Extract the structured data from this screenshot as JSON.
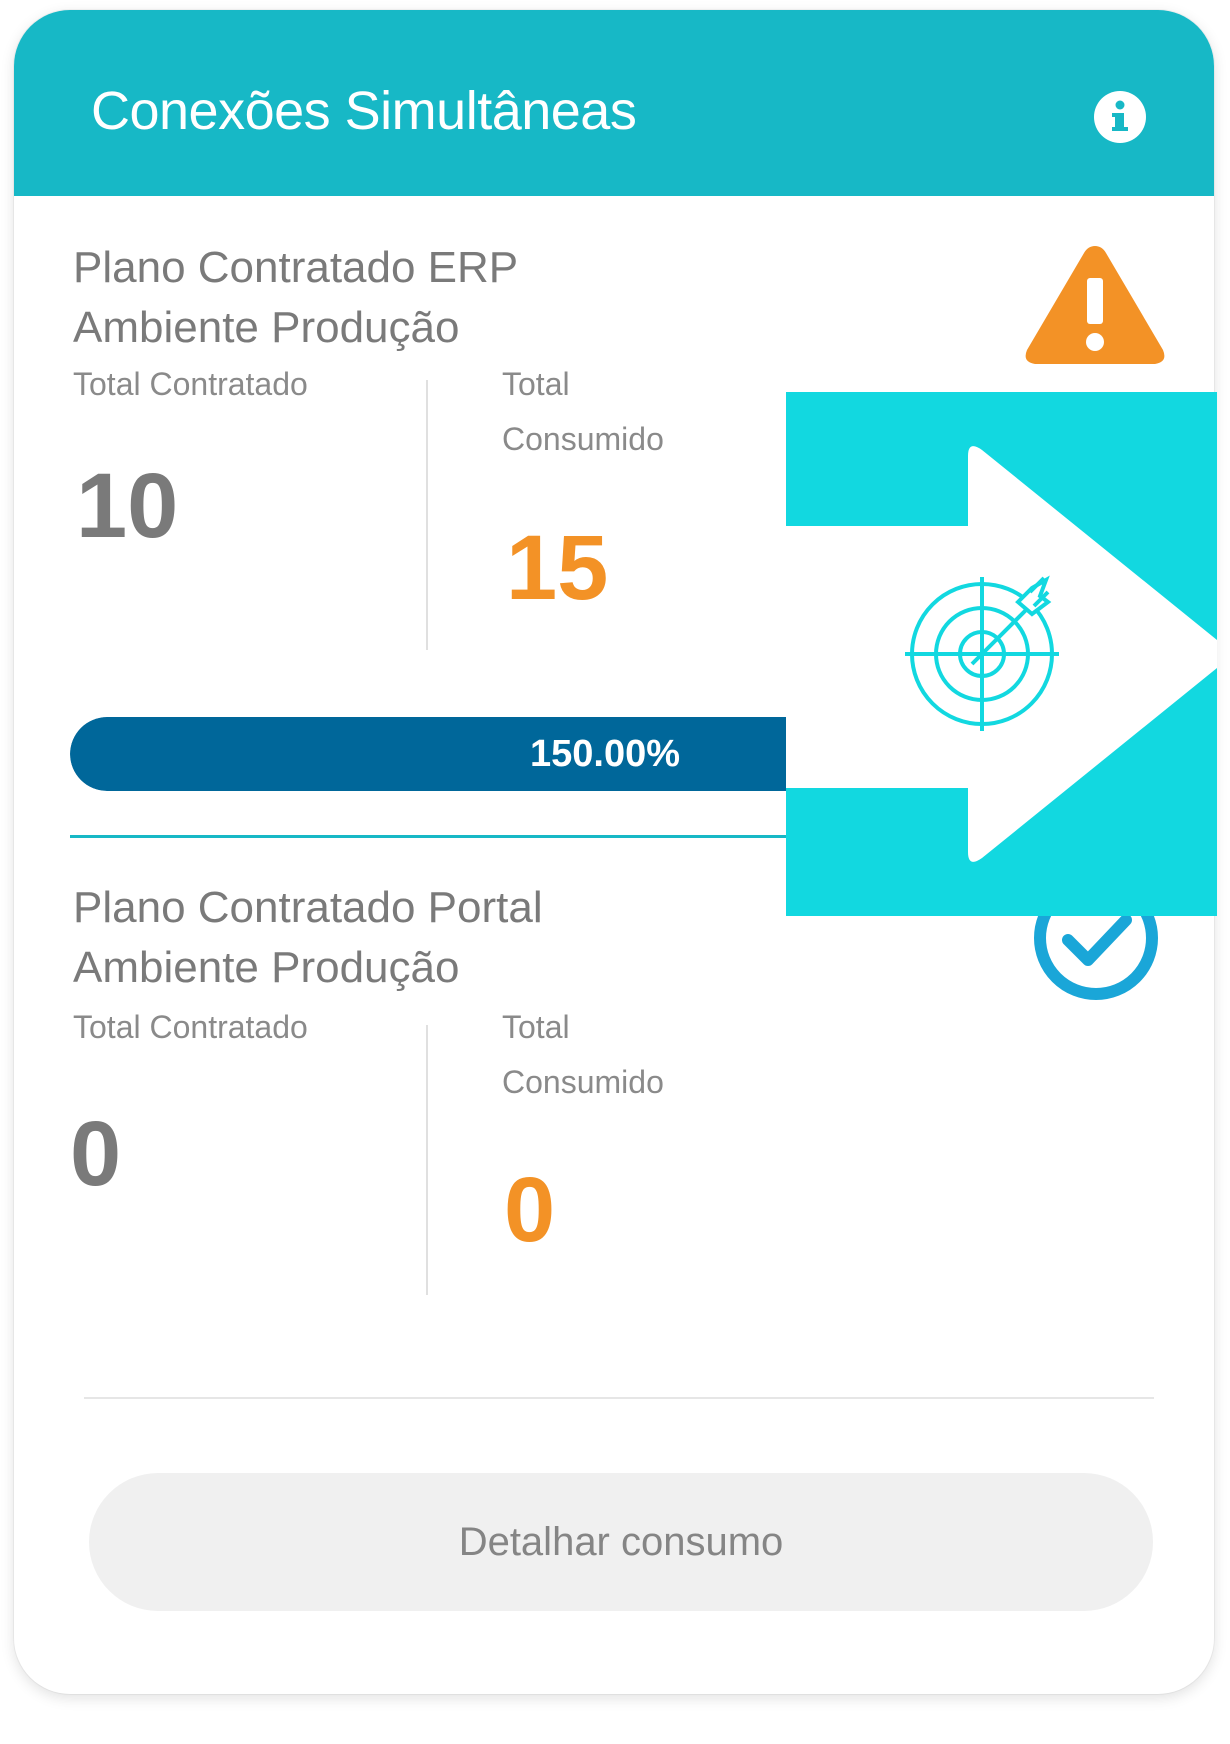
{
  "card": {
    "title": "Conexões Simultâneas",
    "info_icon": "info-circle-icon"
  },
  "plans": [
    {
      "title_line1": "Plano Contratado ERP",
      "title_line2": "Ambiente Produção",
      "status_icon": "warning-triangle-icon",
      "contracted_label": "Total Contratado",
      "contracted_value": "10",
      "consumed_label_line1": "Total",
      "consumed_label_line2": "Consumido",
      "consumed_value": "15",
      "usage_progress_percent": 150,
      "usage_label": "150.00%"
    },
    {
      "title_line1": "Plano Contratado Portal",
      "title_line2": "Ambiente Produção",
      "status_icon": "check-circle-icon",
      "contracted_label": "Total Contratado",
      "contracted_value": "0",
      "consumed_label_line1": "Total",
      "consumed_label_line2": "Consumido",
      "consumed_value": "0"
    }
  ],
  "actions": {
    "detail_label": "Detalhar consumo"
  },
  "overlay": {
    "icon": "target-arrow-icon"
  },
  "colors": {
    "header": "#17b8c6",
    "warning": "#f39226",
    "progress": "#00679a",
    "check": "#1aa6d8",
    "overlay": "#12d8e0"
  }
}
